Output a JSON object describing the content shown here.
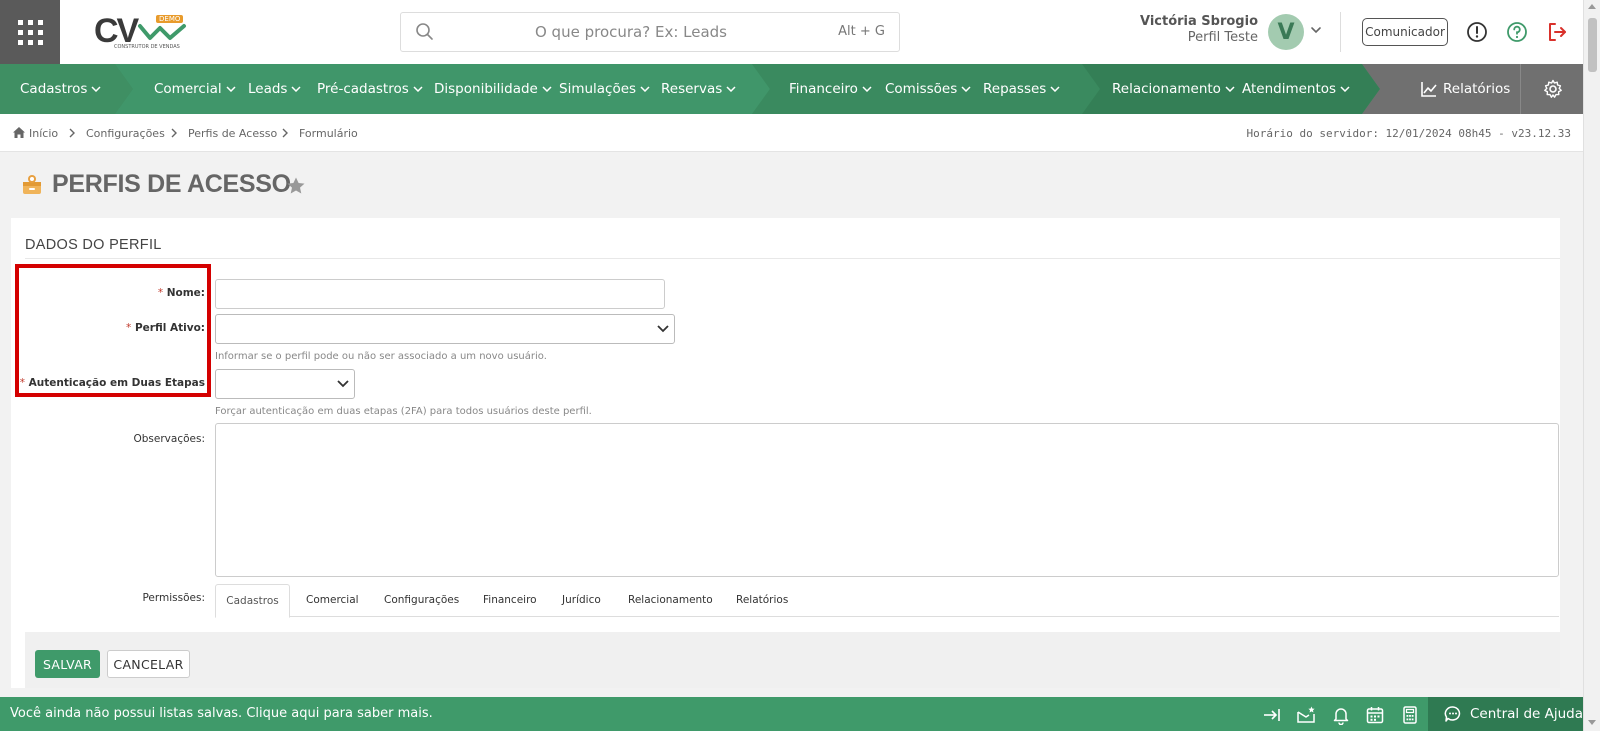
{
  "header": {
    "logo": {
      "text": "CV",
      "badge": "DEMO",
      "subtitle": "CONSTRUTOR DE VENDAS"
    },
    "search": {
      "placeholder": "O que procura? Ex: Leads",
      "shortcut": "Alt + G"
    },
    "user": {
      "name": "Victória Sbrogio",
      "profile": "Perfil Teste",
      "initial": "V"
    },
    "comunicador_label": "Comunicador"
  },
  "nav": {
    "items": [
      {
        "label": "Cadastros"
      },
      {
        "label": "Comercial"
      },
      {
        "label": "Leads"
      },
      {
        "label": "Pré-cadastros"
      },
      {
        "label": "Disponibilidade"
      },
      {
        "label": "Simulações"
      },
      {
        "label": "Reservas"
      },
      {
        "label": "Financeiro"
      },
      {
        "label": "Comissões"
      },
      {
        "label": "Repasses"
      },
      {
        "label": "Relacionamento"
      },
      {
        "label": "Atendimentos"
      }
    ],
    "relatorios_label": "Relatórios"
  },
  "breadcrumb": {
    "items": [
      "Início",
      "Configurações",
      "Perfis de Acesso",
      "Formulário"
    ],
    "server_time": "Horário do servidor: 12/01/2024 08h45 - v23.12.33"
  },
  "page": {
    "title": "PERFIS DE ACESSO",
    "section_title": "DADOS DO PERFIL"
  },
  "form": {
    "nome": {
      "label": "Nome:",
      "value": ""
    },
    "perfil_ativo": {
      "label": "Perfil Ativo:",
      "value": "",
      "hint": "Informar se o perfil pode ou não ser associado a um novo usuário."
    },
    "autenticacao": {
      "label": "Autenticação em Duas Etapas",
      "value": "",
      "hint": "Forçar autenticação em duas etapas (2FA) para todos usuários deste perfil."
    },
    "observacoes": {
      "label": "Observações:",
      "value": ""
    },
    "permissoes": {
      "label": "Permissões:"
    },
    "required_marker": "*"
  },
  "tabs": [
    "Cadastros",
    "Comercial",
    "Configurações",
    "Financeiro",
    "Jurídico",
    "Relacionamento",
    "Relatórios"
  ],
  "buttons": {
    "save": "SALVAR",
    "cancel": "CANCELAR"
  },
  "footer": {
    "message": "Você ainda não possui listas salvas. Clique aqui para saber mais.",
    "help_center": "Central de Ajuda"
  },
  "colors": {
    "nav_green": "#3f8f63",
    "nav_dark_green": "#2f6b4b",
    "accent_green": "#3f9a6a",
    "highlight_red": "#d40000",
    "logout_red": "#d9312b"
  }
}
